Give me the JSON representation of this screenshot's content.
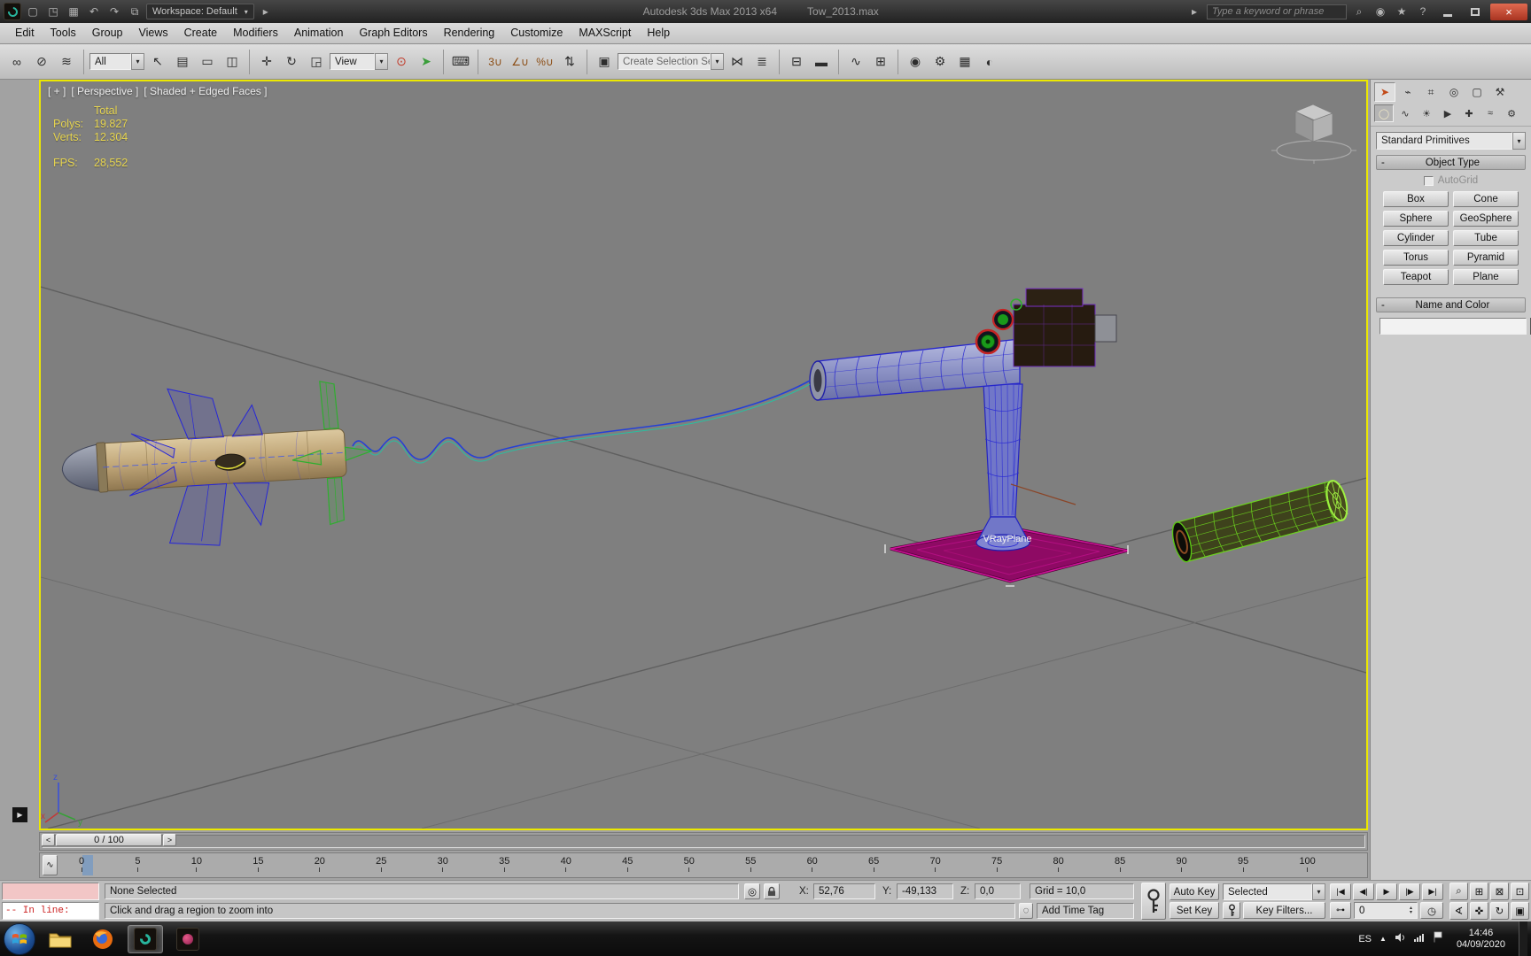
{
  "titlebar": {
    "app_title": "Autodesk 3ds Max 2013 x64",
    "file_name": "Tow_2013.max",
    "workspace": "Workspace: Default",
    "search_placeholder": "Type a keyword or phrase"
  },
  "menubar": {
    "items": [
      "Edit",
      "Tools",
      "Group",
      "Views",
      "Create",
      "Modifiers",
      "Animation",
      "Graph Editors",
      "Rendering",
      "Customize",
      "MAXScript",
      "Help"
    ]
  },
  "toolbar": {
    "selection_filter": "All",
    "ref_coord": "View",
    "named_selection_placeholder": "Create Selection Se"
  },
  "viewport": {
    "menu_general": "[ + ]",
    "menu_pov": "[ Perspective ]",
    "menu_shading": "[ Shaded + Edged Faces ]",
    "stats": {
      "total_label": "Total",
      "polys_label": "Polys:",
      "polys_value": "19.827",
      "verts_label": "Verts:",
      "verts_value": "12.304",
      "fps_label": "FPS:",
      "fps_value": "28,552"
    },
    "object_label": "VRayPlane"
  },
  "command_panel": {
    "primitive_category": "Standard Primitives",
    "object_type": {
      "title": "Object Type",
      "autogrid": "AutoGrid",
      "buttons": [
        "Box",
        "Cone",
        "Sphere",
        "GeoSphere",
        "Cylinder",
        "Tube",
        "Torus",
        "Pyramid",
        "Teapot",
        "Plane"
      ]
    },
    "name_color": {
      "title": "Name and Color",
      "color_hex": "#8c1c36"
    }
  },
  "timeline": {
    "slider_label": "0 / 100",
    "ticks": [
      "0",
      "5",
      "10",
      "15",
      "20",
      "25",
      "30",
      "35",
      "40",
      "45",
      "50",
      "55",
      "60",
      "65",
      "70",
      "75",
      "80",
      "85",
      "90",
      "95",
      "100"
    ]
  },
  "status": {
    "listener_prompt": "--  In line:",
    "selection": "None Selected",
    "x_label": "X:",
    "x_value": "52,76",
    "y_label": "Y:",
    "y_value": "-49,133",
    "z_label": "Z:",
    "z_value": "0,0",
    "grid_value": "Grid = 10,0",
    "prompt": "Click and drag a region to zoom into",
    "add_time_tag": "Add Time Tag"
  },
  "anim": {
    "auto_key": "Auto Key",
    "set_key": "Set Key",
    "selected_set": "Selected",
    "key_filters": "Key Filters...",
    "frame_value": "0"
  },
  "taskbar": {
    "language": "ES",
    "time": "14:46",
    "date": "04/09/2020"
  },
  "icons": {
    "new_scene": "▢",
    "open_file": "◳",
    "save_file": "▦",
    "undo": "↶",
    "redo": "↷",
    "project_folder": "⧉",
    "nav_arrow": "▸",
    "search": "⌕",
    "communication": "◉",
    "favorites": "★",
    "help": "?",
    "close": "×",
    "dropdown": "▾",
    "select_link": "∞",
    "unlink": "⊘",
    "bind_spacewarp": "≋",
    "select_object": "↖",
    "select_by_name": "▤",
    "rect_region": "▭",
    "window_crossing": "◫",
    "move": "✛",
    "rotate": "↻",
    "scale": "◲",
    "use_center": "⊙",
    "manipulate": "➤",
    "keyboard_override": "⌨",
    "snap_3d": "3∪",
    "snap_angle": "∠∪",
    "snap_percent": "%∪",
    "snap_spinner": "⇅",
    "named_sets": "▣",
    "mirror": "⋈",
    "align": "≣",
    "layers": "⊟",
    "ribbon": "▬",
    "curve_editor": "∿",
    "schematic": "⊞",
    "material_editor": "◉",
    "render_setup": "⚙",
    "frame_window": "▦",
    "render": "◐",
    "tab_create": "➤",
    "tab_modify": "⌁",
    "tab_hierarchy": "⌗",
    "tab_motion": "◎",
    "tab_display": "▢",
    "tab_utilities": "⚒",
    "cat_geometry": "◯",
    "cat_shapes": "∿",
    "cat_lights": "☀",
    "cat_cameras": "▶",
    "cat_helpers": "✚",
    "cat_spacewarps": "≈",
    "cat_systems": "⚙",
    "minus": "-",
    "slider_prev": "<",
    "slider_next": ">",
    "mini_curve": "∿",
    "goto_start": "|◀",
    "prev_frame": "◀|",
    "play": "▶",
    "next_frame": "|▶",
    "goto_end": "▶|",
    "key_mode": "⊶",
    "time_config": "◷",
    "nav_zoom": "⌕",
    "nav_zoom_all": "⊞",
    "nav_zoom_ext": "⊠",
    "nav_zoom_ext_all": "⊡",
    "nav_fov": "∢",
    "nav_pan": "✜",
    "nav_orbit": "↻",
    "nav_maximize": "▣",
    "spin_up": "▴",
    "spin_down": "▾",
    "isolate": "◎",
    "comm_center": "◌",
    "tray_hidden": "▲",
    "viewport_tab_arrow": "▶"
  }
}
